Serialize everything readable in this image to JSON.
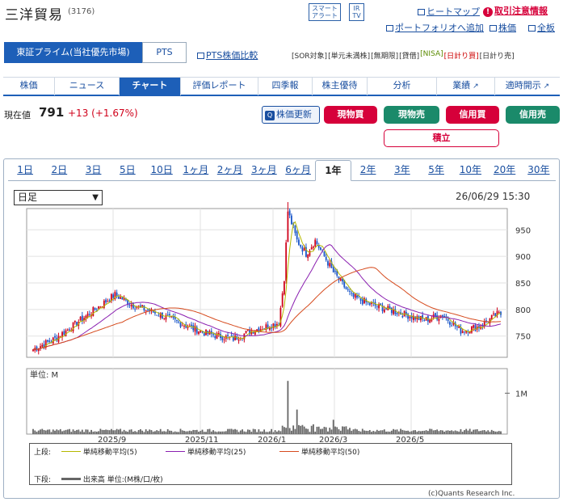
{
  "header": {
    "company": "三洋貿易",
    "code": "(3176)",
    "smart_alert": [
      "スマート",
      "アラート"
    ],
    "ir_tv": [
      "IR",
      "TV"
    ],
    "heatmap": "ヒートマップ",
    "risk": "取引注意情報",
    "portfolio": "ポートフォリオへ追加",
    "stocks": "株価",
    "full": "全板"
  },
  "market": {
    "primary": "東証プライム(当社優先市場)",
    "pts": "PTS",
    "pts_compare": "PTS株価比較"
  },
  "badges": [
    "[SOR];対象",
    "[単元未満株]",
    "[無期限]",
    "[貸借]",
    "[NISA]",
    "[日計り]",
    "[日計り]"
  ],
  "badge_labels": [
    "[SOR対象]",
    "[単元未満株]",
    "[無期限]",
    "[貸借]",
    "[NISA]",
    "[日計り買]",
    "[日計り売]"
  ],
  "nav": [
    "株価",
    "ニュース",
    "チャート",
    "評価レポート",
    "四季報",
    "株主優待",
    "分析",
    "業績",
    "適時開示"
  ],
  "quote": {
    "label": "現在値",
    "price": "791",
    "change": "+13 (+1.67%)",
    "refresh": "株価更新"
  },
  "actions": {
    "cash_buy": "現物買",
    "cash_sell": "現物売",
    "margin_buy": "信用買",
    "margin_sell": "信用売",
    "accumulate": "積立"
  },
  "periods": [
    "1日",
    "2日",
    "3日",
    "5日",
    "10日",
    "1ヶ月",
    "2ヶ月",
    "3ヶ月",
    "6ヶ月",
    "1年",
    "2年",
    "3年",
    "5年",
    "10年",
    "20年",
    "30年"
  ],
  "period_active": "1年",
  "chart_select": "日足",
  "timestamp": "26/06/29 15:30",
  "legend": {
    "upper": "上段:",
    "lower": "下段:",
    "ma5": "単純移動平均(5)",
    "ma25": "単純移動平均(25)",
    "ma50": "単純移動平均(50)",
    "volume": "出来高 単位:(M株/口/枚)"
  },
  "copyright": "(c)Quants Research Inc.",
  "colors": {
    "up": "#d0021b",
    "down": "#1a56c9",
    "ma5": "#b5b800",
    "ma25": "#8a1fb0",
    "ma50": "#d64b1e",
    "volume": "#666666",
    "active_tab": "#1d5fb8",
    "pill_red": "#d6003a",
    "pill_green": "#1a8a6a"
  },
  "chart_data": [
    {
      "type": "candlestick",
      "x_tick_labels": [
        "2025/9",
        "2025/11",
        "2026/1",
        "2026/3",
        "2026/5"
      ],
      "y_ticks": [
        750,
        800,
        850,
        900,
        950
      ],
      "ylim": [
        710,
        990
      ],
      "key_points": [
        [
          0,
          725
        ],
        [
          12,
          745
        ],
        [
          30,
          790
        ],
        [
          45,
          828
        ],
        [
          55,
          808
        ],
        [
          70,
          790
        ],
        [
          80,
          775
        ],
        [
          95,
          755
        ],
        [
          110,
          745
        ],
        [
          120,
          760
        ],
        [
          135,
          775
        ],
        [
          138,
          860
        ],
        [
          140,
          985
        ],
        [
          145,
          930
        ],
        [
          150,
          905
        ],
        [
          155,
          930
        ],
        [
          165,
          870
        ],
        [
          175,
          825
        ],
        [
          185,
          810
        ],
        [
          195,
          800
        ],
        [
          205,
          790
        ],
        [
          215,
          780
        ],
        [
          225,
          790
        ],
        [
          235,
          760
        ],
        [
          245,
          768
        ],
        [
          255,
          791
        ]
      ],
      "volume_y_label": "単位: M",
      "volume_y_ticks": [
        "1M"
      ],
      "volume_max_label": "1M",
      "volume_spikes": [
        [
          140,
          1.3
        ],
        [
          145,
          0.6
        ],
        [
          165,
          0.35
        ]
      ]
    }
  ]
}
